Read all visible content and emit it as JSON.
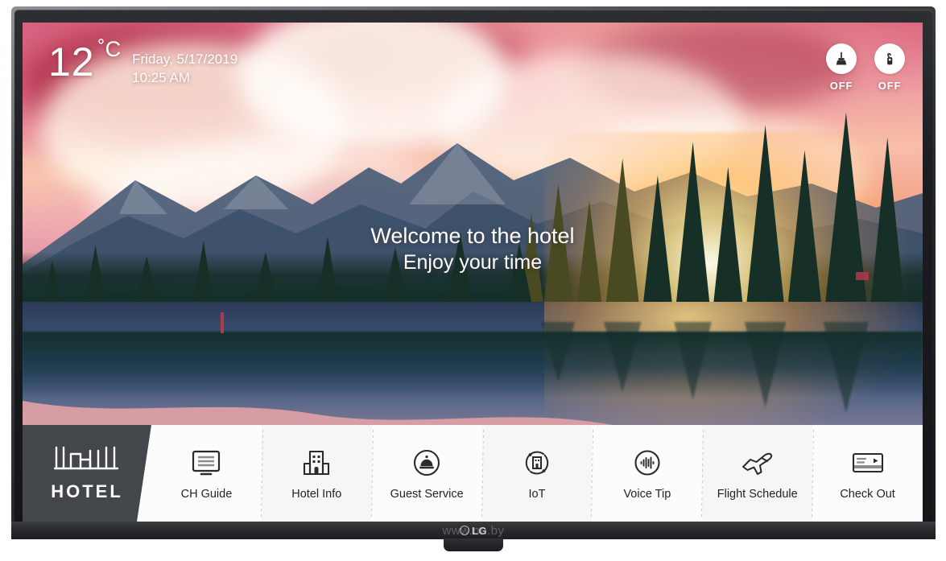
{
  "device": {
    "brand": "LG",
    "watermark": "www.nn.by",
    "bezel_color": "#1b1d20"
  },
  "screen": {
    "weather": {
      "temperature": "12",
      "unit": "˚C",
      "date": "Friday, 5/17/2019",
      "time": "10:25 AM"
    },
    "status_icons": [
      {
        "icon": "housekeeping-brush-icon",
        "label": "OFF"
      },
      {
        "icon": "do-not-disturb-hanger-icon",
        "label": "OFF"
      }
    ],
    "welcome": {
      "title": "Welcome to the hotel",
      "subtitle": "Enjoy your time"
    },
    "wallpaper": {
      "description": "sunset over mountain lake with conifer forest",
      "sky_color": "#e0758a",
      "sun_color": "#ffd67a",
      "water_color": "#3d5173"
    },
    "launcher": {
      "brand_panel": {
        "label": "HOTEL",
        "icon": "hotel-skyline-icon",
        "background": "#43464b"
      },
      "items": [
        {
          "label": "CH Guide",
          "icon": "tv-list-icon"
        },
        {
          "label": "Hotel Info",
          "icon": "building-icon"
        },
        {
          "label": "Guest Service",
          "icon": "service-bell-icon"
        },
        {
          "label": "IoT",
          "icon": "iot-orbit-building-icon"
        },
        {
          "label": "Voice Tip",
          "icon": "voice-waveform-icon"
        },
        {
          "label": "Flight Schedule",
          "icon": "airplane-takeoff-icon"
        },
        {
          "label": "Check Out",
          "icon": "credit-card-icon"
        }
      ]
    }
  }
}
